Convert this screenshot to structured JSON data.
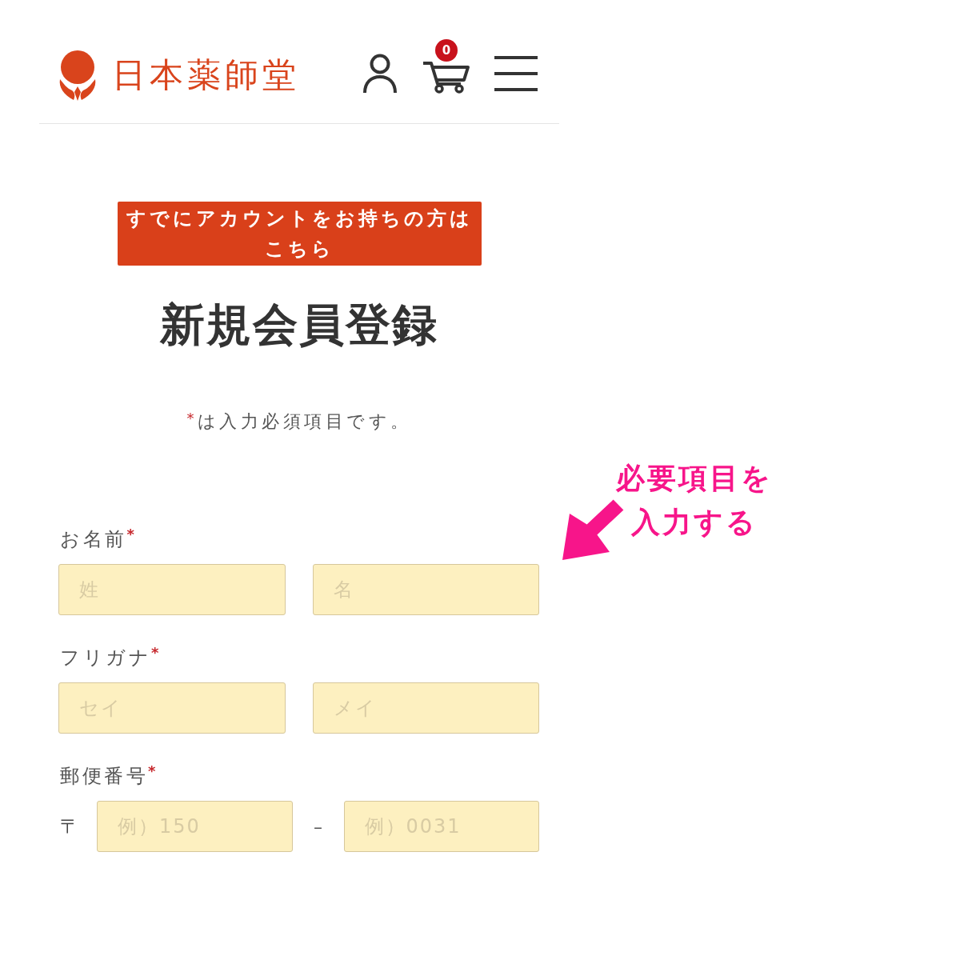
{
  "header": {
    "logo": {
      "text": "日本薬師堂"
    },
    "cart": {
      "count": "0"
    }
  },
  "login_button": {
    "label": "すでにアカウントをお持ちの方はこちら"
  },
  "page_title": "新規会員登録",
  "required_note": {
    "mark": "*",
    "text": "は入力必須項目です。"
  },
  "form": {
    "fields": [
      {
        "kind": "pair",
        "label": "お名前",
        "required_mark": "*",
        "inputs": [
          {
            "placeholder": "姓"
          },
          {
            "placeholder": "名"
          }
        ]
      },
      {
        "kind": "pair",
        "label": "フリガナ",
        "required_mark": "*",
        "inputs": [
          {
            "placeholder": "セイ"
          },
          {
            "placeholder": "メイ"
          }
        ]
      },
      {
        "kind": "postal",
        "label": "郵便番号",
        "required_mark": "*",
        "prefix": "〒",
        "separator": "–",
        "inputs": [
          {
            "placeholder": "例）150"
          },
          {
            "placeholder": "例）0031"
          }
        ]
      }
    ]
  },
  "annotation": {
    "text": "必要項目を入力する"
  }
}
